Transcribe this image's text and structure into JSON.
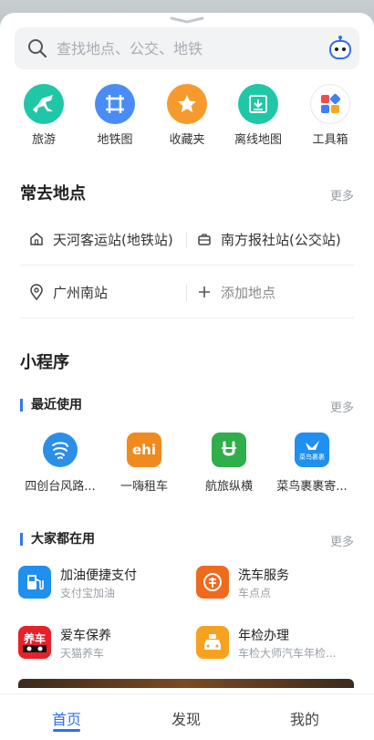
{
  "search": {
    "placeholder": "查找地点、公交、地铁"
  },
  "quick_actions": [
    {
      "label": "旅游",
      "icon": "horse-icon",
      "color": "#1fc7a6"
    },
    {
      "label": "地铁图",
      "icon": "metro-icon",
      "color": "#4a8cf5"
    },
    {
      "label": "收藏夹",
      "icon": "star-icon",
      "color": "#f79a2e"
    },
    {
      "label": "离线地图",
      "icon": "download-icon",
      "color": "#1fc7a6"
    },
    {
      "label": "工具箱",
      "icon": "toolbox-icon",
      "color": "#ffffff"
    }
  ],
  "frequent": {
    "title": "常去地点",
    "more": "更多",
    "places": [
      {
        "label": "天河客运站(地铁站)",
        "icon": "home-icon"
      },
      {
        "label": "南方报社站(公交站)",
        "icon": "briefcase-icon"
      },
      {
        "label": "广州南站",
        "icon": "location-pin-icon"
      },
      {
        "label": "添加地点",
        "icon": "plus-icon"
      }
    ]
  },
  "mini_programs": {
    "title": "小程序",
    "recent": {
      "title": "最近使用",
      "more": "更多",
      "items": [
        {
          "label": "四创台风路...",
          "icon": "typhoon-icon",
          "color": "#2b8fe8"
        },
        {
          "label": "一嗨租车",
          "icon": "ehi-logo",
          "text": "ehi",
          "color": "#f08a1e"
        },
        {
          "label": "航旅纵横",
          "icon": "plane-logo",
          "color": "#2fae4a"
        },
        {
          "label": "菜鸟裹裹寄...",
          "icon": "cainiao-logo",
          "text": "菜鸟裹裹",
          "color": "#1f8ff0"
        }
      ]
    },
    "popular": {
      "title": "大家都在用",
      "more": "更多",
      "items": [
        {
          "title": "加油便捷支付",
          "subtitle": "支付宝加油",
          "icon": "fuel-icon",
          "color": "#1f8ff0"
        },
        {
          "title": "洗车服务",
          "subtitle": "车点点",
          "icon": "carwash-icon",
          "color": "#f06a1e"
        },
        {
          "title": "爱车保养",
          "subtitle": "天猫养车",
          "icon": "tmall-car-icon",
          "text": "养车",
          "color": "#e8202a"
        },
        {
          "title": "年检办理",
          "subtitle": "车检大师汽车年检...",
          "icon": "inspection-icon",
          "color": "#f7a21e"
        }
      ]
    }
  },
  "tabs": [
    {
      "label": "首页",
      "active": true
    },
    {
      "label": "发现",
      "active": false
    },
    {
      "label": "我的",
      "active": false
    }
  ]
}
